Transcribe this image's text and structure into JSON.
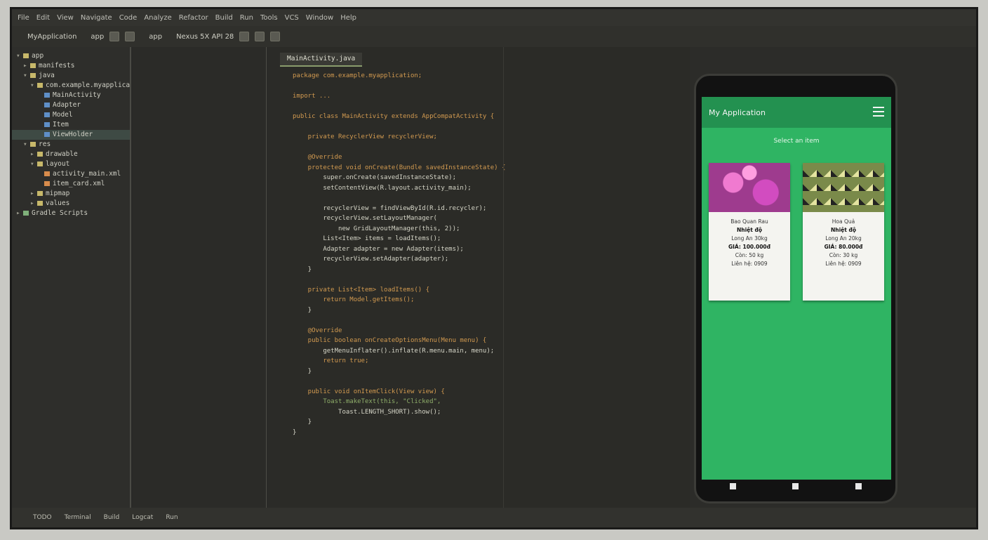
{
  "menubar": {
    "items": [
      "File",
      "Edit",
      "View",
      "Navigate",
      "Code",
      "Analyze",
      "Refactor",
      "Build",
      "Run",
      "Tools",
      "VCS",
      "Window",
      "Help"
    ]
  },
  "toolbar": {
    "project_label": "MyApplication",
    "module_label": "app",
    "run_config": "app",
    "device": "Nexus 5X API 28"
  },
  "project_panel": {
    "items": [
      {
        "label": "app",
        "depth": 0,
        "folder": true
      },
      {
        "label": "manifests",
        "depth": 1,
        "folder": true
      },
      {
        "label": "java",
        "depth": 1,
        "folder": true
      },
      {
        "label": "com.example.myapplication",
        "depth": 2,
        "folder": true
      },
      {
        "label": "MainActivity",
        "depth": 3,
        "folder": false
      },
      {
        "label": "Adapter",
        "depth": 3,
        "folder": false
      },
      {
        "label": "Model",
        "depth": 3,
        "folder": false
      },
      {
        "label": "Item",
        "depth": 3,
        "folder": false
      },
      {
        "label": "ViewHolder",
        "depth": 3,
        "folder": false
      },
      {
        "label": "res",
        "depth": 1,
        "folder": true
      },
      {
        "label": "drawable",
        "depth": 2,
        "folder": true
      },
      {
        "label": "layout",
        "depth": 2,
        "folder": true
      },
      {
        "label": "activity_main.xml",
        "depth": 3,
        "folder": false
      },
      {
        "label": "item_card.xml",
        "depth": 3,
        "folder": false
      },
      {
        "label": "mipmap",
        "depth": 2,
        "folder": true
      },
      {
        "label": "values",
        "depth": 2,
        "folder": true
      },
      {
        "label": "Gradle Scripts",
        "depth": 0,
        "folder": true
      }
    ]
  },
  "editor": {
    "tab": "MainActivity.java",
    "lines": [
      "package com.example.myapplication;",
      "",
      "import ...",
      "",
      "public class MainActivity extends AppCompatActivity {",
      "",
      "    private RecyclerView recyclerView;",
      "",
      "    @Override",
      "    protected void onCreate(Bundle savedInstanceState) {",
      "        super.onCreate(savedInstanceState);",
      "        setContentView(R.layout.activity_main);",
      "",
      "        recyclerView = findViewById(R.id.recycler);",
      "        recyclerView.setLayoutManager(",
      "            new GridLayoutManager(this, 2));",
      "        List<Item> items = loadItems();",
      "        Adapter adapter = new Adapter(items);",
      "        recyclerView.setAdapter(adapter);",
      "    }",
      "",
      "    private List<Item> loadItems() {",
      "        return Model.getItems();",
      "    }",
      "",
      "    @Override",
      "    public boolean onCreateOptionsMenu(Menu menu) {",
      "        getMenuInflater().inflate(R.menu.main, menu);",
      "        return true;",
      "    }",
      "",
      "    public void onItemClick(View view) {",
      "        Toast.makeText(this, \"Clicked\",",
      "            Toast.LENGTH_SHORT).show();",
      "    }",
      "}"
    ]
  },
  "phone": {
    "app_title": "My Application",
    "subtitle": "Select an item",
    "cards": [
      {
        "name": "Bao Quan Rau",
        "line1": "Nhiệt độ",
        "line2": "Long An 30kg",
        "line3": "GIÁ: 100.000đ",
        "line4": "Còn: 50 kg",
        "line5": "Liên hệ: 0909"
      },
      {
        "name": "Hoa Quả",
        "line1": "Nhiệt độ",
        "line2": "Long An 20kg",
        "line3": "GIÁ: 80.000đ",
        "line4": "Còn: 30 kg",
        "line5": "Liên hệ: 0909"
      }
    ]
  },
  "statusbar": {
    "items": [
      "TODO",
      "Terminal",
      "Build",
      "Logcat",
      "Run"
    ]
  },
  "colors": {
    "app_green": "#2fb463",
    "appbar_green": "#239150",
    "ide_bg": "#2b2b27"
  }
}
